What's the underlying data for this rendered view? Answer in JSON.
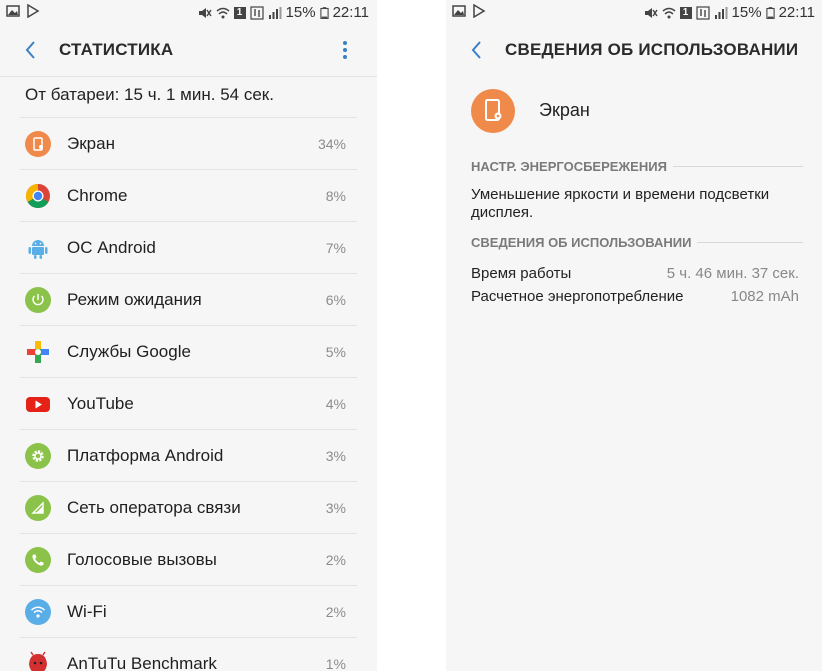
{
  "status_bar": {
    "battery_percent": "15%",
    "time": "22:11",
    "sim_slot": "1"
  },
  "left": {
    "title": "СТАТИСТИКА",
    "battery_summary": "От батареи: 15 ч. 1 мин. 54 сек.",
    "items": [
      {
        "label": "Экран",
        "percent": "34%",
        "icon": "screen-icon",
        "color": "#f08a4b"
      },
      {
        "label": "Chrome",
        "percent": "8%",
        "icon": "chrome-icon",
        "color": "#4285f4"
      },
      {
        "label": "ОС Android",
        "percent": "7%",
        "icon": "android-icon",
        "color": "#5aaee8"
      },
      {
        "label": "Режим ожидания",
        "percent": "6%",
        "icon": "power-icon",
        "color": "#8bc34a"
      },
      {
        "label": "Службы Google",
        "percent": "5%",
        "icon": "google-play-services-icon",
        "color": "#34a853"
      },
      {
        "label": "YouTube",
        "percent": "4%",
        "icon": "youtube-icon",
        "color": "#e62117"
      },
      {
        "label": "Платформа Android",
        "percent": "3%",
        "icon": "gear-icon",
        "color": "#8bc34a"
      },
      {
        "label": "Сеть оператора связи",
        "percent": "3%",
        "icon": "cell-signal-icon",
        "color": "#8bc34a"
      },
      {
        "label": "Голосовые вызовы",
        "percent": "2%",
        "icon": "phone-icon",
        "color": "#8bc34a"
      },
      {
        "label": "Wi-Fi",
        "percent": "2%",
        "icon": "wifi-icon",
        "color": "#5aaee8"
      },
      {
        "label": "AnTuTu Benchmark",
        "percent": "1%",
        "icon": "antutu-icon",
        "color": "#d32f2f"
      }
    ]
  },
  "right": {
    "title": "СВЕДЕНИЯ ОБ ИСПОЛЬЗОВАНИИ",
    "app_name": "Экран",
    "power_saving_header": "НАСТР. ЭНЕРГОСБЕРЕЖЕНИЯ",
    "power_saving_text": "Уменьшение яркости и времени подсветки дисплея.",
    "usage_header": "СВЕДЕНИЯ ОБ ИСПОЛЬЗОВАНИИ",
    "usage_rows": [
      {
        "key": "Время работы",
        "value": "5 ч. 46 мин. 37 сек."
      },
      {
        "key": "Расчетное энергопотребление",
        "value": "1082 mAh"
      }
    ]
  }
}
